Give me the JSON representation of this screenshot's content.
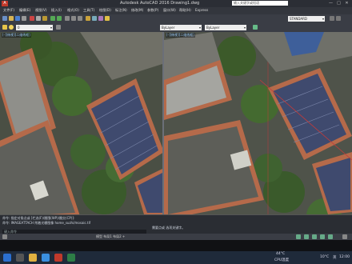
{
  "window": {
    "app_icon_label": "A",
    "title": "Autodesk AutoCAD 2016    Drawing1.dwg",
    "help_search_placeholder": "输入关键字或短语",
    "minimize": "—",
    "maximize": "□",
    "close": "✕"
  },
  "menubar": {
    "items": [
      "文件(F)",
      "编辑(E)",
      "视图(V)",
      "插入(I)",
      "格式(O)",
      "工具(T)",
      "绘图(D)",
      "标注(N)",
      "修改(M)",
      "参数(P)",
      "窗口(W)",
      "帮助(H)",
      "Express"
    ]
  },
  "toolbar": {
    "workspace": "STANDARD",
    "layer": "0",
    "color": "ByLayer",
    "linetype": "ByLayer"
  },
  "viewports": {
    "left_label": "[-][俯视][二维线框]",
    "right_label": "[-][俯视][二维线框]"
  },
  "command": {
    "lines": [
      "命令: 指定对角点或 [栏选(F)/圈围(WP)/圈交(CP)]:",
      "命令: IMAGEATTACH 附着光栅图像 home_suzhi/mosaic.tif",
      "需要点或 选项关键字。"
    ],
    "input_placeholder": "键入命令"
  },
  "statusbar": {
    "text": "模型  布局1  布局2  +"
  },
  "taskbar": {
    "weather_temp": "44°C",
    "weather_label": "CPU温度",
    "clock_temp": "10°C",
    "lang": "英",
    "time": "12:00"
  },
  "colors": {
    "accent": "#2b6fcf",
    "roof_tile": "#b56a4a"
  }
}
